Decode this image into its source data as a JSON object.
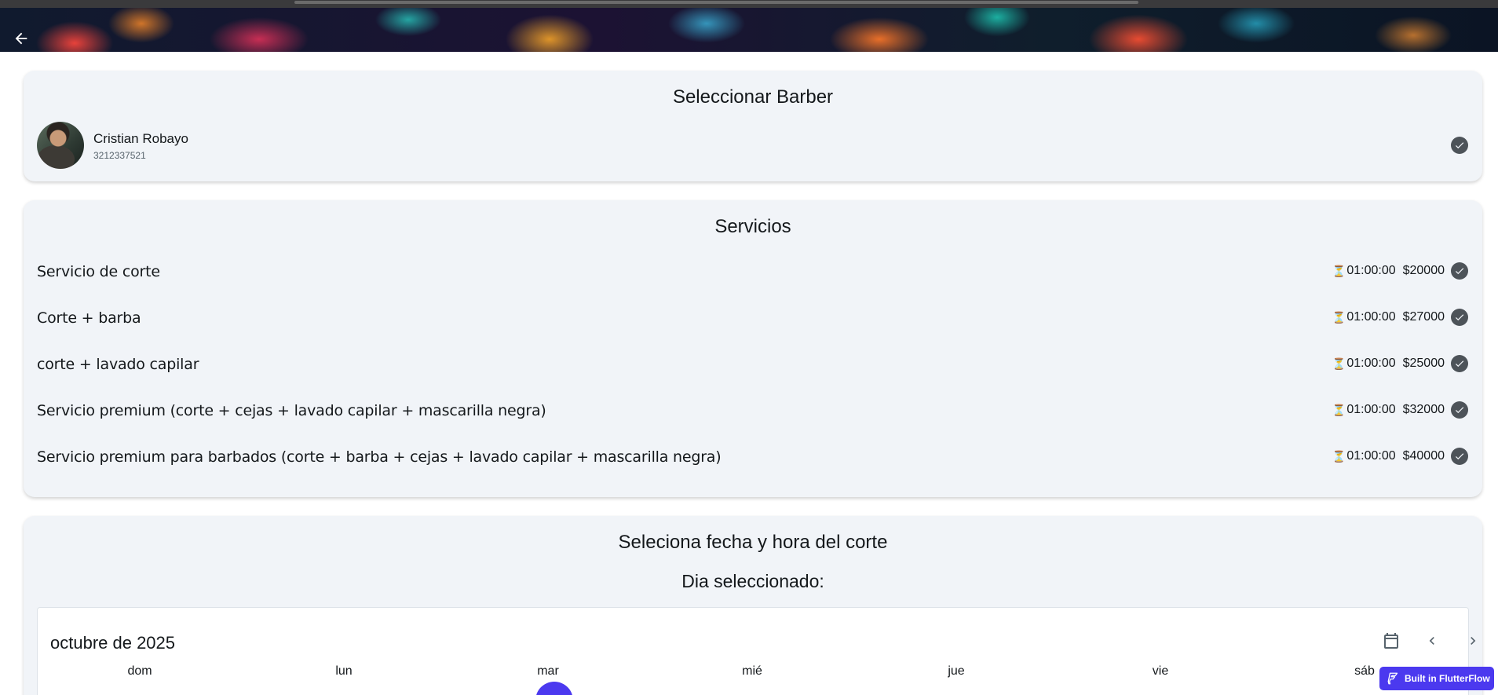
{
  "barber_section": {
    "title": "Seleccionar  Barber",
    "barber": {
      "name": "Cristian Robayo",
      "phone": "3212337521",
      "selected": true
    }
  },
  "services_section": {
    "title": "Servicios",
    "items": [
      {
        "name": "Servicio de corte",
        "duration": "01:00:00",
        "price": "$20000",
        "selected": true
      },
      {
        "name": "Corte + barba",
        "duration": "01:00:00",
        "price": "$27000",
        "selected": true
      },
      {
        "name": "corte + lavado capilar",
        "duration": "01:00:00",
        "price": "$25000",
        "selected": true
      },
      {
        "name": "Servicio premium (corte + cejas + lavado capilar + mascarilla negra)",
        "duration": "01:00:00",
        "price": "$32000",
        "selected": true
      },
      {
        "name": "Servicio premium para barbados (corte + barba + cejas + lavado capilar + mascarilla negra)",
        "duration": "01:00:00",
        "price": "$40000",
        "selected": true
      }
    ],
    "duration_icon": "⏳"
  },
  "date_section": {
    "title": "Seleciona fecha y hora del corte",
    "subtitle": "Dia seleccionado:",
    "calendar": {
      "month_label": "octubre de 2025",
      "weekdays": [
        "dom",
        "lun",
        "mar",
        "mié",
        "jue",
        "vie",
        "sáb"
      ],
      "selected_weekday": "mar"
    }
  },
  "icons": {
    "back": "arrow-left-icon",
    "check": "check-circle-icon",
    "calendar": "calendar-icon",
    "prev": "chevron-left-icon",
    "next": "chevron-right-icon"
  },
  "colors": {
    "card_background": "#f1f4f8",
    "check": "#4d5359",
    "accent": "#4b39ef"
  },
  "badge": {
    "label": "Built in FlutterFlow"
  }
}
